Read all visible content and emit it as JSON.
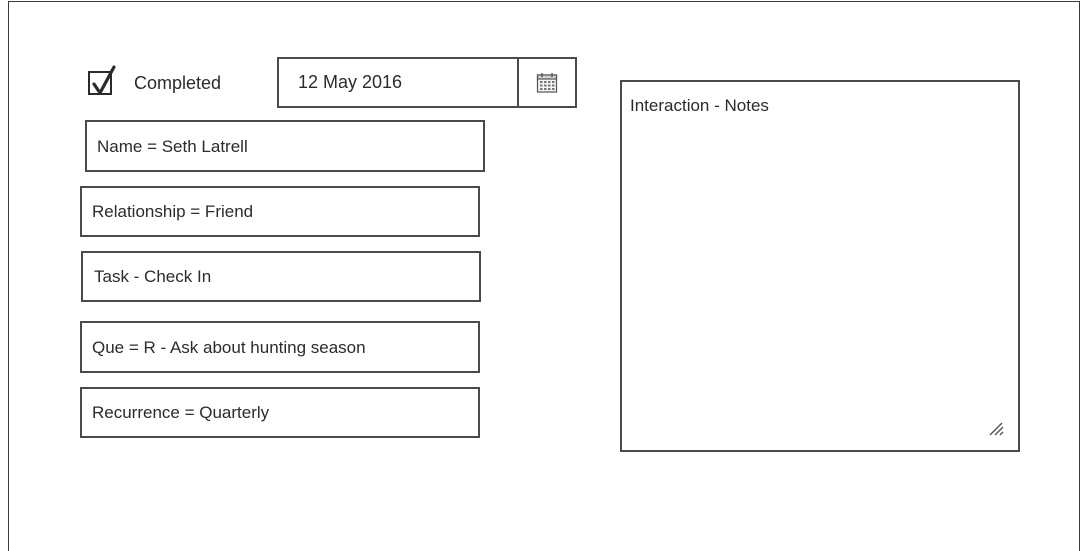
{
  "form": {
    "completed": {
      "label": "Completed",
      "checked": true
    },
    "date": {
      "value": "12 May 2016",
      "button_icon": "calendar-icon"
    },
    "fields": {
      "name": "Name = Seth Latrell",
      "relationship": "Relationship = Friend",
      "task": "Task - Check In",
      "que": "Que = R - Ask about hunting season",
      "recurrence": "Recurrence = Quarterly"
    },
    "notes": {
      "placeholder": "Interaction - Notes",
      "resize_icon": "resize-grip-icon"
    }
  }
}
